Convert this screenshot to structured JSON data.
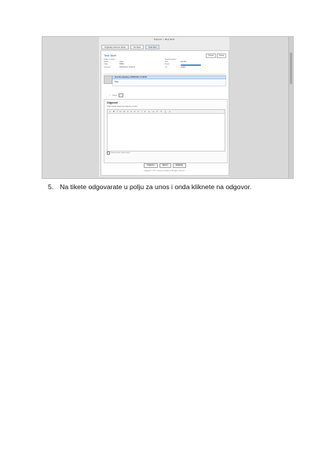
{
  "screenshot": {
    "header": "Support > Moji tiketi",
    "tabs": [
      "Pogledaj otvorene tikete",
      "Svi tiketi",
      "Novi tiket"
    ],
    "active_tab": 2,
    "ticket_title": "Test tiket",
    "tool_buttons": [
      "Prihvati",
      "Zatvori"
    ],
    "info_left": [
      {
        "k": "Podaci o tiketu",
        "v": ""
      },
      {
        "k": "Status",
        "v": "Open"
      },
      {
        "k": "Odjel",
        "v": "SPAS"
      },
      {
        "k": "Otvoreno",
        "v": "26/05/2011 13:48:05"
      }
    ],
    "info_right": [
      {
        "k": "Kontakt podaci",
        "v": ""
      },
      {
        "k": "Ime",
        "v": "Eva Ma"
      },
      {
        "k": "Email",
        "v": ""
      },
      {
        "k": "Tel",
        "v": "mobile"
      }
    ],
    "message_header": "Eva Ma napisala je 26/05/2011 13:48:05",
    "message_body": "Test",
    "attachment_label": "Prilozi",
    "reply_title": "Odgovori",
    "reply_note": "Ovdje mozete unijeti tekst odgovora na tiket",
    "editor_tools": [
      "✂",
      "B",
      "I",
      "U",
      "S",
      "≡",
      "≡",
      "≡",
      "≡",
      "•",
      "1.",
      "⇤",
      "⇥",
      "↶",
      "↷",
      "⚓",
      "∞"
    ],
    "editor_option": "Prikazi poruku nakon slanja",
    "buttons": [
      "Odgovori",
      "Zatvori",
      "Zaključaj"
    ],
    "footer": "Copyright © 2011. Sva prava pridržana. All rights reserved."
  },
  "caption": {
    "number": "5.",
    "text": "Na tikete odgovarate u polju za unos i onda kliknete na odgovor."
  }
}
